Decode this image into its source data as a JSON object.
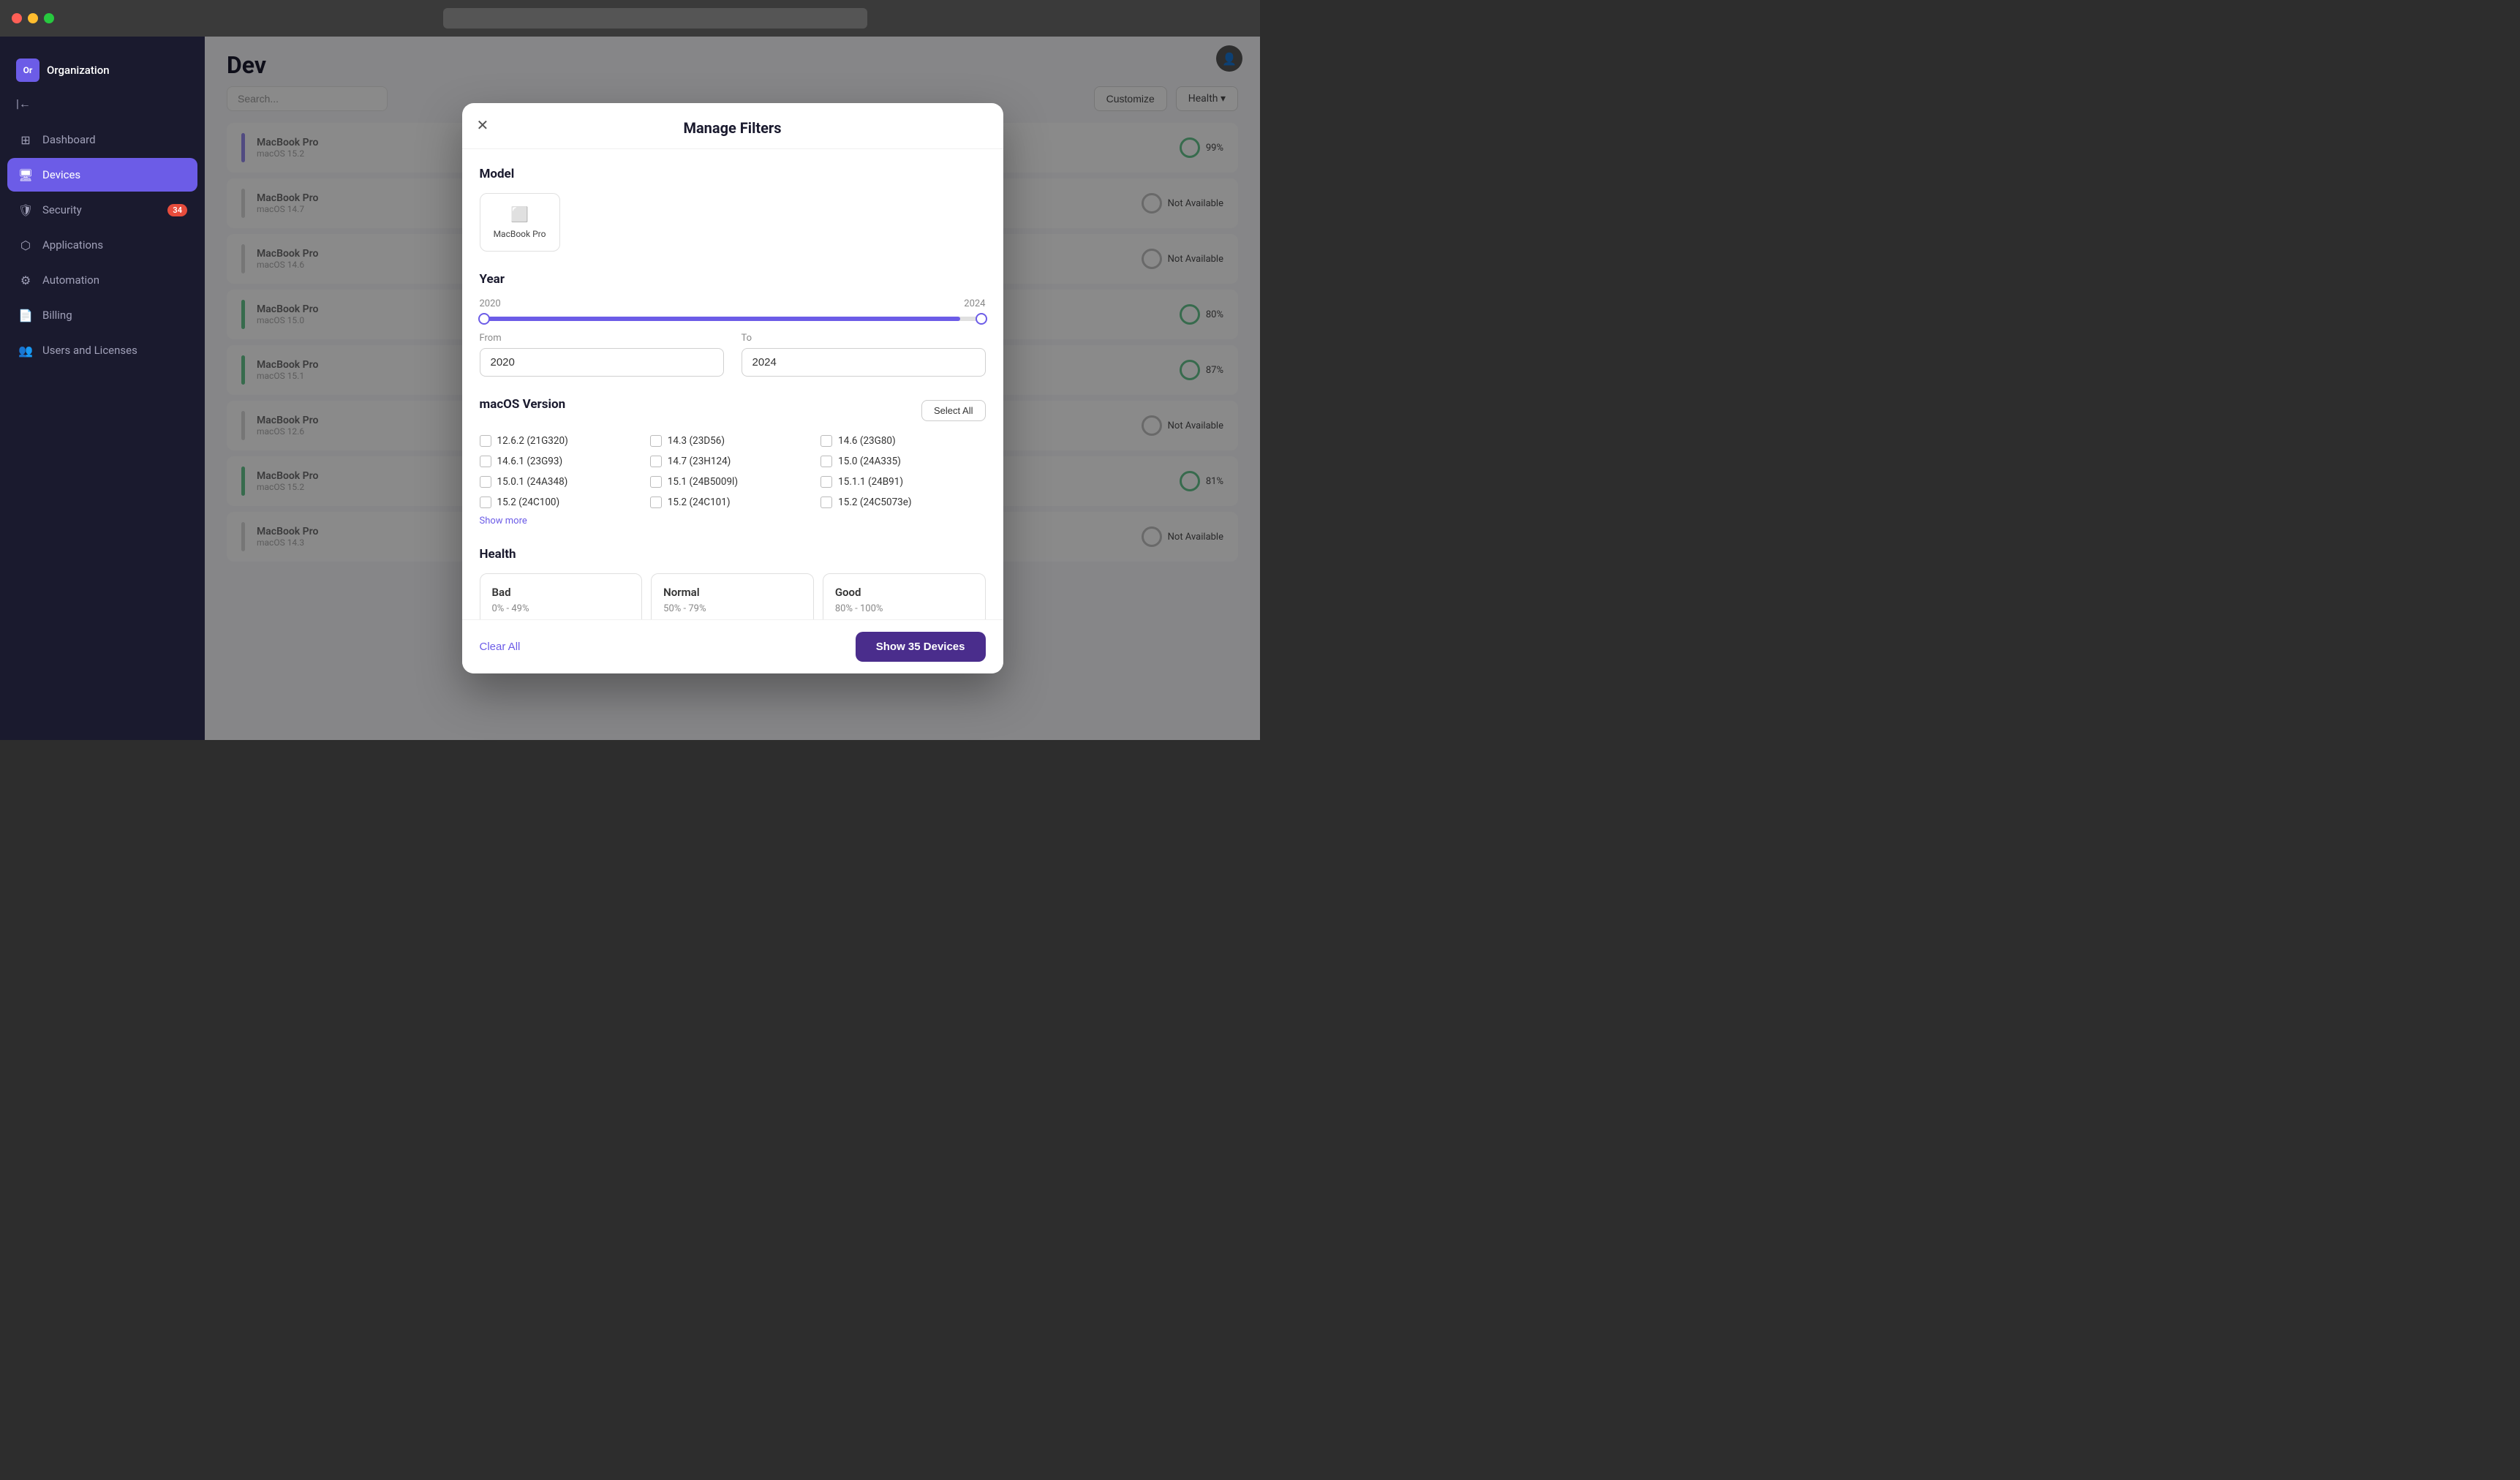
{
  "browser": {
    "traffic_lights": [
      "red",
      "yellow",
      "green"
    ]
  },
  "sidebar": {
    "org_label": "Or",
    "org_name": "Organization",
    "items": [
      {
        "id": "dashboard",
        "label": "Dashboard",
        "icon": "⊞",
        "active": false,
        "badge": null
      },
      {
        "id": "devices",
        "label": "Devices",
        "icon": "🖥",
        "active": true,
        "badge": null
      },
      {
        "id": "security",
        "label": "Security",
        "icon": "🛡",
        "active": false,
        "badge": "34"
      },
      {
        "id": "applications",
        "label": "Applications",
        "icon": "⬡",
        "active": false,
        "badge": null
      },
      {
        "id": "automation",
        "label": "Automation",
        "icon": "⚙",
        "active": false,
        "badge": null
      },
      {
        "id": "billing",
        "label": "Billing",
        "icon": "📄",
        "active": false,
        "badge": null
      },
      {
        "id": "users-licenses",
        "label": "Users and Licenses",
        "icon": "👥",
        "active": false,
        "badge": null
      }
    ]
  },
  "main": {
    "page_title": "Dev",
    "toolbar": {
      "search_placeholder": "Search...",
      "customize_label": "Customize",
      "health_filter_label": "Health"
    }
  },
  "modal": {
    "title": "Manage Filters",
    "close_label": "✕",
    "sections": {
      "model": {
        "title": "Model",
        "items": [
          {
            "name": "MacBook Pro",
            "icon": "⬜"
          }
        ]
      },
      "year": {
        "title": "Year",
        "from_label": "From",
        "to_label": "To",
        "from_value": "2020",
        "to_value": "2024",
        "min_year": "2020",
        "max_year": "2024"
      },
      "macos_version": {
        "title": "macOS Version",
        "select_all_label": "Select All",
        "versions": [
          "12.6.2 (21G320)",
          "14.3 (23D56)",
          "14.6 (23G80)",
          "14.6.1 (23G93)",
          "14.7 (23H124)",
          "15.0 (24A335)",
          "15.0.1 (24A348)",
          "15.1 (24B5009l)",
          "15.1.1 (24B91)",
          "15.2 (24C100)",
          "15.2 (24C101)",
          "15.2 (24C5073e)"
        ],
        "show_more_label": "Show more"
      },
      "health": {
        "title": "Health",
        "cards": [
          {
            "label": "Bad",
            "range": "0% - 49%"
          },
          {
            "label": "Normal",
            "range": "50% - 79%"
          },
          {
            "label": "Good",
            "range": "80% - 100%"
          }
        ]
      }
    },
    "footer": {
      "clear_all_label": "Clear All",
      "show_devices_label": "Show 35 Devices"
    }
  },
  "device_rows": [
    {
      "health": "99%",
      "health_class": "green"
    },
    {
      "health": "N/A",
      "health_class": "gray"
    },
    {
      "health": "N/A",
      "health_class": "gray"
    },
    {
      "health": "80%",
      "health_class": "green"
    },
    {
      "health": "87%",
      "health_class": "green"
    },
    {
      "health": "N/A",
      "health_class": "gray"
    },
    {
      "health": "81%",
      "health_class": "green"
    },
    {
      "health": "N/A",
      "health_class": "gray"
    }
  ]
}
